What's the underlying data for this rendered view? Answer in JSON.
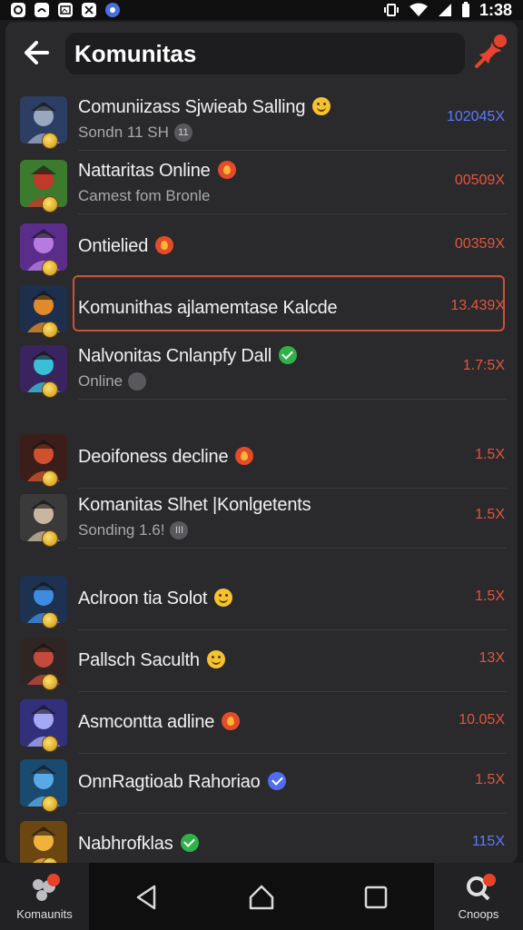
{
  "status_bar": {
    "time": "1:38"
  },
  "header": {
    "title": "Komunitas"
  },
  "items": [
    {
      "name": "Comuniizass Sjwieab Salling",
      "sub": "Sondn 11 SH",
      "mult": "102045X",
      "mult_color": "blue",
      "emoji": "smile",
      "sub_badge": "11",
      "avatar": "knight"
    },
    {
      "name": "Nattaritas Online",
      "sub": "Camest fom Bronle",
      "mult": "00509X",
      "emoji": "fire",
      "avatar": "red-hat"
    },
    {
      "name": "Ontielied",
      "sub": "",
      "mult": "00359X",
      "emoji": "fire",
      "avatar": "purple"
    },
    {
      "name": "Komunithas ajlamemtase Kalcde",
      "sub": "",
      "mult": "13.439X",
      "emoji": "",
      "avatar": "mage"
    },
    {
      "name": "Nalvonitas Cnlanpfy Dall",
      "sub": "Online",
      "mult": "1.7:5X",
      "emoji": "check",
      "sub_badge": "",
      "avatar": "blaster"
    },
    {
      "name": "Deoifoness decline",
      "sub": "",
      "mult": "1.5X",
      "emoji": "fire",
      "avatar": "cannon"
    },
    {
      "name": "Komanitas Slhet |Konlgetents",
      "sub": "Sonding 1.6!",
      "mult": "1.5X",
      "emoji": "",
      "sub_badge": "III",
      "avatar": "cowboy"
    },
    {
      "name": "Aclroon tia Solot",
      "sub": "",
      "mult": "1.5X",
      "emoji": "smile",
      "avatar": "robot"
    },
    {
      "name": "Pallsch Saculth",
      "sub": "",
      "mult": "13X",
      "emoji": "smile",
      "avatar": "warrior"
    },
    {
      "name": "Asmcontta adline",
      "sub": "",
      "mult": "10.05X",
      "emoji": "fire",
      "avatar": "gun"
    },
    {
      "name": "OnnRagtioab Rahoriao",
      "sub": "",
      "mult": "1.5X",
      "emoji": "verify",
      "avatar": "armor"
    },
    {
      "name": "Nabhrofklas",
      "sub": "",
      "mult": "115X",
      "mult_color": "blue",
      "emoji": "check",
      "avatar": "gold"
    }
  ],
  "nav": {
    "left_label": "Komaunits",
    "right_label": "Cnoops"
  },
  "colors": {
    "accent": "#e0553f",
    "blue": "#5d79ff",
    "panel": "#2a2a2c"
  }
}
